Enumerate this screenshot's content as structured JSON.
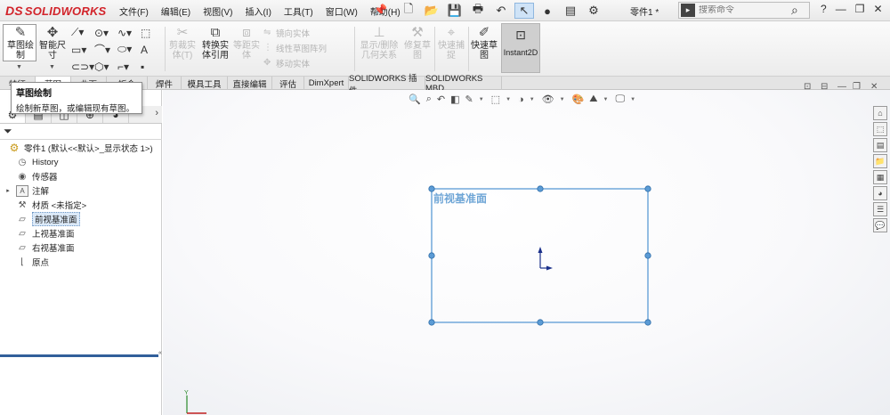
{
  "app": {
    "logo_mark": "DS",
    "logo_text": "SOLIDWORKS",
    "brand_color": "#d2232a"
  },
  "menu": [
    "文件(F)",
    "编辑(E)",
    "视图(V)",
    "插入(I)",
    "工具(T)",
    "窗口(W)",
    "帮助(H)"
  ],
  "document": {
    "name": "零件1 *"
  },
  "search": {
    "placeholder": "搜索命令"
  },
  "window_controls": [
    "?",
    "—",
    "❐",
    "✕"
  ],
  "command_manager": {
    "sketch": "草图绘\n制",
    "smart_dim": "智能尺\n寸",
    "trim": "剪裁实\n体(T)",
    "convert": "转换实\n体引用",
    "offset": "等距实\n体",
    "mirror": "镜向实体",
    "linear_pattern": "线性草图阵列",
    "move": "移动实体",
    "display_relations": "显示/删除\n几何关系",
    "repair": "修复草\n图",
    "quick_snaps": "快速捕\n捉",
    "rapid_sketch": "快速草\n图",
    "instant2d": "Instant2D"
  },
  "tabs": [
    {
      "label": "特征"
    },
    {
      "label": "草图"
    },
    {
      "label": "曲面"
    },
    {
      "label": "钣金"
    },
    {
      "label": "焊件"
    },
    {
      "label": "模具工具"
    },
    {
      "label": "直接编辑"
    },
    {
      "label": "评估"
    },
    {
      "label": "DimXpert"
    },
    {
      "label": "SOLIDWORKS 插件"
    },
    {
      "label": "SOLIDWORKS MBD"
    }
  ],
  "tooltip": {
    "title": "草图绘制",
    "description": "绘制新草图，或编辑现有草图。"
  },
  "tree": {
    "root": "零件1 (默认<<默认>_显示状态 1>)",
    "history": "History",
    "sensors": "传感器",
    "annotations": "注解",
    "material": "材质 <未指定>",
    "front_plane": "前视基准面",
    "top_plane": "上视基准面",
    "right_plane": "右视基准面",
    "origin": "原点"
  },
  "graphics": {
    "plane_label": "前视基准面",
    "plane_color": "#5b9bd5",
    "selection_color": "#dbe9f8"
  }
}
